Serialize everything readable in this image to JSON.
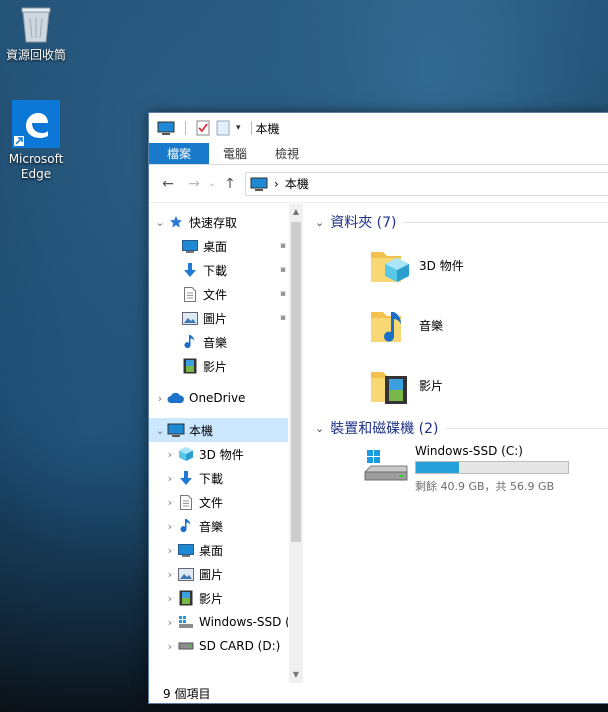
{
  "desktop": {
    "recycle_bin_label": "資源回收筒",
    "edge_label_line1": "Microsoft",
    "edge_label_line2": "Edge"
  },
  "window": {
    "title": "本機",
    "ribbon_tabs": [
      "檔案",
      "電腦",
      "檢視"
    ],
    "address": {
      "path": "本機",
      "separator": "›"
    }
  },
  "nav_pane": {
    "items": [
      {
        "label": "快速存取",
        "icon": "star-icon"
      },
      {
        "label": "桌面",
        "icon": "desktop-folder-icon"
      },
      {
        "label": "下載",
        "icon": "download-arrow-icon"
      },
      {
        "label": "文件",
        "icon": "document-icon"
      },
      {
        "label": "圖片",
        "icon": "pictures-icon"
      },
      {
        "label": "音樂",
        "icon": "music-note-icon"
      },
      {
        "label": "影片",
        "icon": "film-icon"
      },
      {
        "label": "OneDrive",
        "icon": "cloud-icon"
      },
      {
        "label": "本機",
        "icon": "computer-icon"
      },
      {
        "label": "3D 物件",
        "icon": "cube-icon"
      },
      {
        "label": "下載",
        "icon": "download-arrow-icon"
      },
      {
        "label": "文件",
        "icon": "document-icon"
      },
      {
        "label": "音樂",
        "icon": "music-note-icon"
      },
      {
        "label": "桌面",
        "icon": "desktop-folder-icon"
      },
      {
        "label": "圖片",
        "icon": "pictures-icon"
      },
      {
        "label": "影片",
        "icon": "film-icon"
      },
      {
        "label": "Windows-SSD (",
        "icon": "windows-drive-icon"
      },
      {
        "label": "SD CARD (D:)",
        "icon": "sd-card-icon"
      }
    ]
  },
  "main": {
    "folders_header": "資料夾 (7)",
    "folders": [
      {
        "label": "3D 物件",
        "icon": "cube-folder-icon"
      },
      {
        "label": "音樂",
        "icon": "music-folder-icon"
      },
      {
        "label": "影片",
        "icon": "video-folder-icon"
      }
    ],
    "devices_header": "裝置和磁碟機 (2)",
    "drive": {
      "name": "Windows-SSD (C:)",
      "free_text": "剩餘 40.9 GB，共 56.9 GB",
      "used_fraction": 0.28
    }
  },
  "status": {
    "item_count": "9 個項目"
  },
  "colors": {
    "accent": "#1979ca",
    "header_text": "#1e3287",
    "drive_fill": "#26a0da",
    "selection": "#cce8ff"
  }
}
